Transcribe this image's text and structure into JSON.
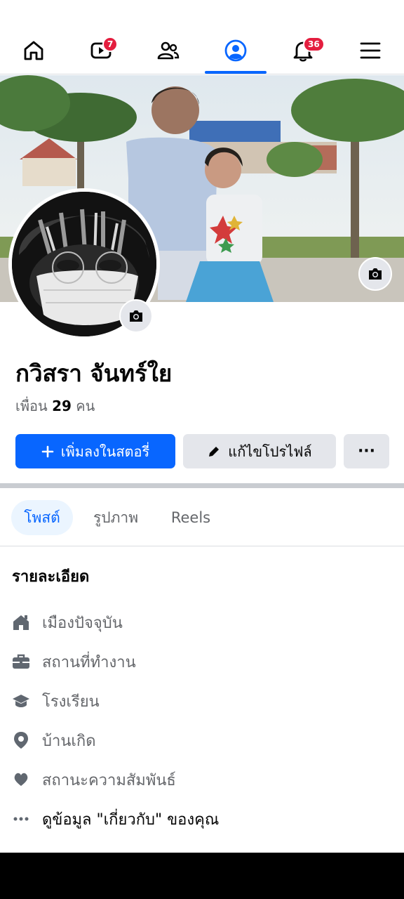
{
  "nav": {
    "tabs": [
      {
        "name": "home",
        "icon": "home-icon"
      },
      {
        "name": "video",
        "icon": "video-icon",
        "badge": "7"
      },
      {
        "name": "friends",
        "icon": "friends-icon"
      },
      {
        "name": "profile",
        "icon": "profile-icon",
        "active": true
      },
      {
        "name": "notifications",
        "icon": "bell-icon",
        "badge": "36"
      },
      {
        "name": "menu",
        "icon": "menu-icon"
      }
    ],
    "accent": "#0866ff",
    "badge_color": "#e41e3f"
  },
  "profile": {
    "name": "กวิสรา จันทร์ใย",
    "friends_prefix": "เพื่อน",
    "friends_count": "29",
    "friends_suffix": "คน"
  },
  "actions": {
    "add_story": "เพิ่มลงในสตอรี่",
    "edit_profile": "แก้ไขโปรไฟล์",
    "more": "···"
  },
  "tabs": [
    {
      "label": "โพสต์",
      "active": true
    },
    {
      "label": "รูปภาพ",
      "active": false
    },
    {
      "label": "Reels",
      "active": false
    }
  ],
  "details": {
    "title": "รายละเอียด",
    "items": [
      {
        "icon": "home-icon",
        "label": "เมืองปัจจุบัน"
      },
      {
        "icon": "briefcase-icon",
        "label": "สถานที่ทำงาน"
      },
      {
        "icon": "graduation-cap-icon",
        "label": "โรงเรียน"
      },
      {
        "icon": "location-pin-icon",
        "label": "บ้านเกิด"
      },
      {
        "icon": "heart-icon",
        "label": "สถานะความสัมพันธ์"
      },
      {
        "icon": "more-dots-icon",
        "label": "ดูข้อมูล \"เกี่ยวกับ\" ของคุณ"
      }
    ]
  }
}
